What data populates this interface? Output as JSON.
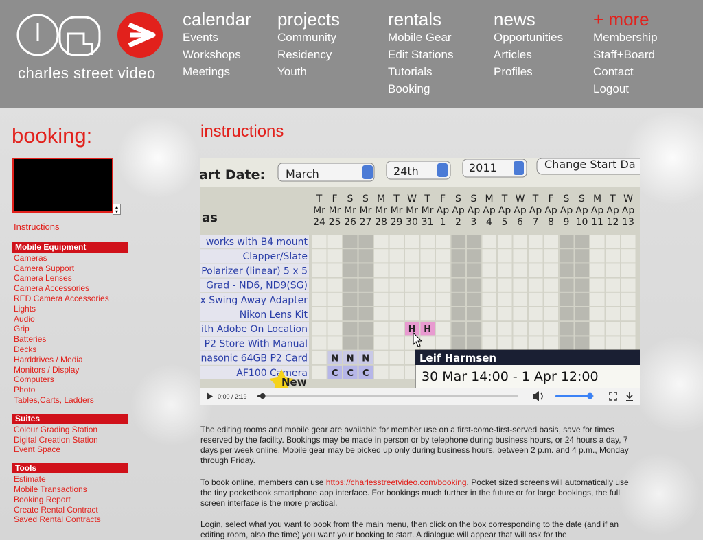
{
  "brand": {
    "name": "charles street video",
    "accent": "#e2211c"
  },
  "nav": [
    {
      "heading": "calendar",
      "items": [
        "Events",
        "Workshops",
        "Meetings"
      ]
    },
    {
      "heading": "projects",
      "items": [
        "Community",
        "Residency",
        "Youth"
      ]
    },
    {
      "heading": "rentals",
      "items": [
        "Mobile Gear",
        "Edit Stations",
        "Tutorials",
        "Booking"
      ]
    },
    {
      "heading": "news",
      "items": [
        "Opportunities",
        "Articles",
        "Profiles"
      ]
    },
    {
      "heading": "+ more",
      "items": [
        "Membership",
        "Staff+Board",
        "Contact",
        "Logout"
      ]
    }
  ],
  "sidebar": {
    "title": "booking:",
    "instructions": "Instructions",
    "groups": [
      {
        "heading": "Mobile Equipment",
        "items": [
          "Cameras",
          "Camera Support",
          "Camera Lenses",
          "Camera Accessories",
          "RED Camera Accessories",
          "Lights",
          "Audio",
          "Grip",
          "Batteries",
          "Decks",
          "Harddrives / Media",
          "Monitors / Display",
          "Computers",
          "Photo",
          "Tables,Carts, Ladders"
        ]
      },
      {
        "heading": "Suites",
        "items": [
          "Colour Grading Station",
          "Digital Creation Station",
          "Event Space"
        ]
      },
      {
        "heading": "Tools",
        "items": [
          "Estimate",
          "Mobile Transactions",
          "Booking Report",
          "Create Rental Contract",
          "Saved Rental Contracts"
        ]
      }
    ]
  },
  "main": {
    "title": "instructions",
    "video": {
      "start_label": "art Date:",
      "month": "March",
      "day": "24th",
      "year": "2011",
      "change_btn": "Change Start Da",
      "equip_header": "as",
      "days": [
        {
          "d": "T",
          "m": "Mr",
          "n": "24"
        },
        {
          "d": "F",
          "m": "Mr",
          "n": "25"
        },
        {
          "d": "S",
          "m": "Mr",
          "n": "26"
        },
        {
          "d": "S",
          "m": "Mr",
          "n": "27"
        },
        {
          "d": "M",
          "m": "Mr",
          "n": "28"
        },
        {
          "d": "T",
          "m": "Mr",
          "n": "29"
        },
        {
          "d": "W",
          "m": "Mr",
          "n": "30"
        },
        {
          "d": "T",
          "m": "Mr",
          "n": "31"
        },
        {
          "d": "F",
          "m": "Ap",
          "n": "1"
        },
        {
          "d": "S",
          "m": "Ap",
          "n": "2"
        },
        {
          "d": "S",
          "m": "Ap",
          "n": "3"
        },
        {
          "d": "M",
          "m": "Ap",
          "n": "4"
        },
        {
          "d": "T",
          "m": "Ap",
          "n": "5"
        },
        {
          "d": "W",
          "m": "Ap",
          "n": "6"
        },
        {
          "d": "T",
          "m": "Ap",
          "n": "7"
        },
        {
          "d": "F",
          "m": "Ap",
          "n": "8"
        },
        {
          "d": "S",
          "m": "Ap",
          "n": "9"
        },
        {
          "d": "S",
          "m": "Ap",
          "n": "10"
        },
        {
          "d": "M",
          "m": "Ap",
          "n": "11"
        },
        {
          "d": "T",
          "m": "Ap",
          "n": "12"
        },
        {
          "d": "W",
          "m": "Ap",
          "n": "13"
        }
      ],
      "rows": [
        "works with B4 mount",
        "Clapper/Slate",
        "Polarizer (linear) 5 x 5",
        "Grad - ND6, ND9(SG)",
        "x Swing Away Adapter",
        "Nikon Lens Kit",
        "ith Adobe On Location",
        "P2 Store With Manual",
        "nasonic 64GB P2 Card",
        "AF100 Camera"
      ],
      "new_badge": "New",
      "h_mark": "H",
      "n_mark": "N",
      "c_mark": "C",
      "tooltip_name": "Leif Harmsen",
      "tooltip_range": "30 Mar 14:00 - 1 Apr 12:00",
      "time": "0:00 / 2:19",
      "progress": 0.02,
      "volume": 0.9
    },
    "paragraphs": [
      {
        "text": "The editing rooms and mobile gear are available for member use on a first-come-first-served basis, save for times reserved by the facility. Bookings may be made in person or by telephone during business hours,  or 24 hours a day, 7 days per week online. Mobile gear may be picked up only during business hours, between 2 p.m. and 4 p.m., Monday through Friday."
      },
      {
        "pre": "To book online, members can use ",
        "link": "https://charlesstreetvideo.com/booking",
        "post": ". Pocket sized screens will automatically use the tiny pocketbook smartphone app interface. For bookings much further in the future or for large bookings, the full screen interface is the more practical."
      },
      {
        "text": "Login, select what you want to book from the main menu, then click on the box corresponding to the date (and if an editing room, also the time) you want your booking to start.  A dialogue will appear that will ask for the"
      }
    ]
  }
}
